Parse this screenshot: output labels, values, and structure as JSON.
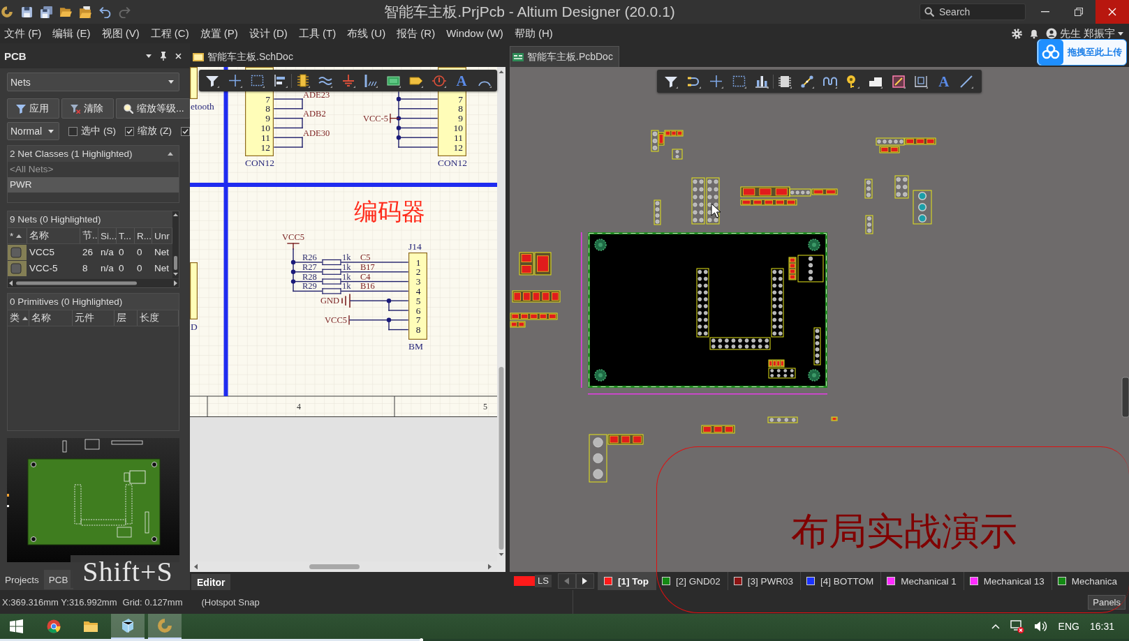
{
  "window": {
    "title": "智能车主板.PrjPcb - Altium Designer (20.0.1)",
    "search_placeholder": "Search"
  },
  "menu": [
    "文件 (F)",
    "编辑 (E)",
    "视图 (V)",
    "工程 (C)",
    "放置 (P)",
    "设计 (D)",
    "工具 (T)",
    "布线 (U)",
    "报告 (R)",
    "Window (W)",
    "帮助 (H)"
  ],
  "account": {
    "name": "先生 郑振宇"
  },
  "upload_badge": {
    "label": "拖拽至此上传"
  },
  "panel": {
    "title": "PCB",
    "mode": "Nets",
    "buttons": [
      "应用",
      "清除",
      "缩放等级..."
    ],
    "highlight_mode": "Normal",
    "options": [
      {
        "label": "选中 (S)",
        "checked": false
      },
      {
        "label": "缩放 (Z)",
        "checked": true
      },
      {
        "checked": true
      }
    ],
    "net_classes": {
      "header": "2 Net Classes (1 Highlighted)",
      "rows": [
        {
          "label": "<All Nets>",
          "dimmed": true,
          "selected": false
        },
        {
          "label": "PWR",
          "dimmed": false,
          "selected": true
        }
      ]
    },
    "nets": {
      "header": "9 Nets (0 Highlighted)",
      "swatch_column": "*",
      "columns": [
        "名称",
        "节..",
        "Si...",
        "T...",
        "R...",
        "Unr"
      ],
      "rows": [
        [
          "VCC5",
          "26",
          "n/a",
          "0",
          "0",
          "Net"
        ],
        [
          "VCC-5",
          "8",
          "n/a",
          "0",
          "0",
          "Net"
        ]
      ]
    },
    "primitives": {
      "header": "0 Primitives (0 Highlighted)",
      "columns": [
        "类",
        "名称",
        "元件",
        "层",
        "长度"
      ]
    },
    "tabs": [
      {
        "label": "Projects",
        "selected": false
      },
      {
        "label": "PCB",
        "selected": true
      }
    ]
  },
  "documents": [
    {
      "label": "智能车主板.SchDoc",
      "kind": "schematic",
      "selected": false
    },
    {
      "label": "智能车主板.PcbDoc",
      "kind": "pcb",
      "selected": true
    }
  ],
  "schematic": {
    "toolbar": {
      "text_tool": "A"
    },
    "partial_labels": [
      "etooth",
      "D"
    ],
    "connectors": [
      {
        "pins": [
          "7",
          "8",
          "9",
          "10",
          "11",
          "12"
        ],
        "comment": "CON12"
      },
      {
        "pins": [
          "7",
          "8",
          "9",
          "10",
          "11",
          "12"
        ],
        "comment": "CON12"
      }
    ],
    "net_labels": [
      "ADE23",
      "ADB2",
      "ADE30"
    ],
    "power_port": "VCC-5",
    "section_title": "编码器",
    "encoder": {
      "supply": "VCC5",
      "resistors": [
        {
          "designator": "R26",
          "value": "1k",
          "net": "C5"
        },
        {
          "designator": "R27",
          "value": "1k",
          "net": "B17"
        },
        {
          "designator": "R28",
          "value": "1k",
          "net": "C4"
        },
        {
          "designator": "R29",
          "value": "1k",
          "net": "B16"
        }
      ],
      "ground": "GND",
      "supply_2": "VCC5",
      "designator": "J14",
      "pins": [
        "1",
        "2",
        "3",
        "4",
        "5",
        "6",
        "7",
        "8"
      ],
      "comment": "BM"
    },
    "frame_zones": [
      "4",
      "5"
    ]
  },
  "editor_tab": {
    "label": "Editor",
    "selected": true
  },
  "pcb": {
    "toolbar": {
      "text_tool": "A"
    },
    "layer_set": "LS",
    "layers": [
      {
        "label": "[1] Top",
        "color": "#ff1a1a",
        "selected": true
      },
      {
        "label": "[2] GND02",
        "color": "#148a14",
        "selected": false
      },
      {
        "label": "[3] PWR03",
        "color": "#8c1414",
        "selected": false
      },
      {
        "label": "[4] BOTTOM",
        "color": "#1a32ff",
        "selected": false
      },
      {
        "label": "Mechanical 1",
        "color": "#ff2cff",
        "selected": false
      },
      {
        "label": "Mechanical 13",
        "color": "#ff2cff",
        "selected": false
      },
      {
        "label": "Mechanica",
        "color": "#148a14",
        "selected": false
      }
    ]
  },
  "status_bar": {
    "coordinates": "X:369.316mm Y:316.992mm",
    "grid": "Grid: 0.127mm",
    "snap": "(Hotspot Snap",
    "panels_button": "Panels"
  },
  "taskbar": {
    "apps": [
      {
        "kind": "start",
        "active": false
      },
      {
        "kind": "browser",
        "active": false
      },
      {
        "kind": "folder",
        "active": false
      },
      {
        "kind": "app",
        "active": true
      },
      {
        "kind": "designer",
        "active": true
      }
    ],
    "language": "ENG",
    "time": "16:31"
  },
  "overlays": {
    "shortcut": "Shift+S",
    "annotation": "布局实战演示",
    "video_progress": {
      "level": 0.375
    }
  }
}
